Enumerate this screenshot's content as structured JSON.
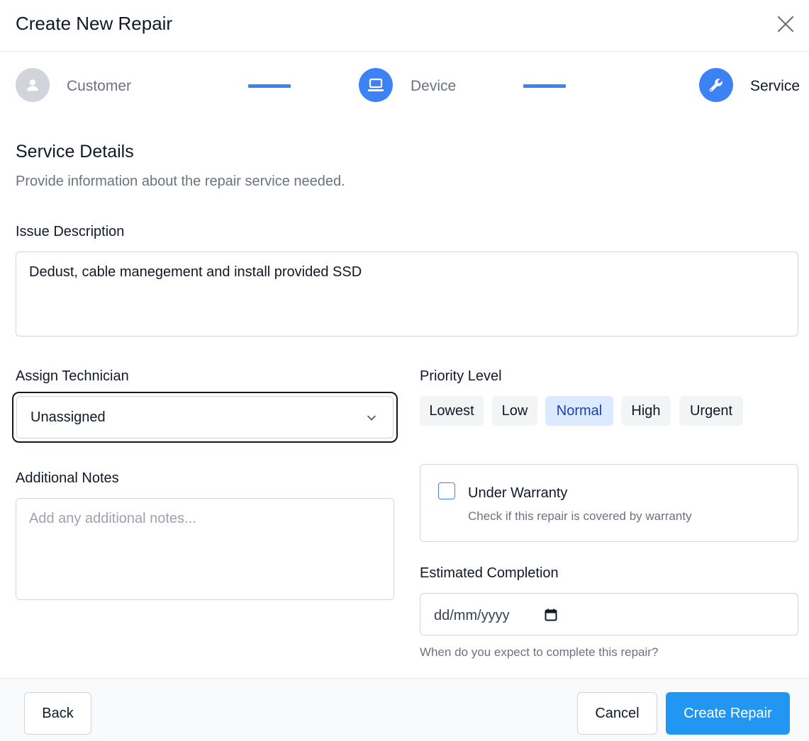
{
  "dialog": {
    "title": "Create New Repair"
  },
  "stepper": {
    "steps": [
      {
        "label": "Customer",
        "icon": "user-icon",
        "state": "inactive"
      },
      {
        "label": "Device",
        "icon": "laptop-icon",
        "state": "complete"
      },
      {
        "label": "Service",
        "icon": "wrench-icon",
        "state": "current"
      }
    ]
  },
  "section": {
    "title": "Service Details",
    "subtitle": "Provide information about the repair service needed."
  },
  "issue": {
    "label": "Issue Description",
    "value": "Dedust, cable manegement and install provided SSD"
  },
  "technician": {
    "label": "Assign Technician",
    "selected": "Unassigned"
  },
  "priority": {
    "label": "Priority Level",
    "options": [
      "Lowest",
      "Low",
      "Normal",
      "High",
      "Urgent"
    ],
    "selected": "Normal"
  },
  "notes": {
    "label": "Additional Notes",
    "placeholder": "Add any additional notes..."
  },
  "warranty": {
    "title": "Under Warranty",
    "description": "Check if this repair is covered by warranty",
    "checked": false
  },
  "completion": {
    "label": "Estimated Completion",
    "placeholder": "dd/mm/yyyy",
    "help": "When do you expect to complete this repair?"
  },
  "footer": {
    "back_label": "Back",
    "cancel_label": "Cancel",
    "create_label": "Create Repair"
  },
  "colors": {
    "accent": "#3b82f6",
    "primary_button": "#2196f3",
    "selected_priority_bg": "#dbeafe",
    "selected_priority_text": "#1e40af"
  }
}
